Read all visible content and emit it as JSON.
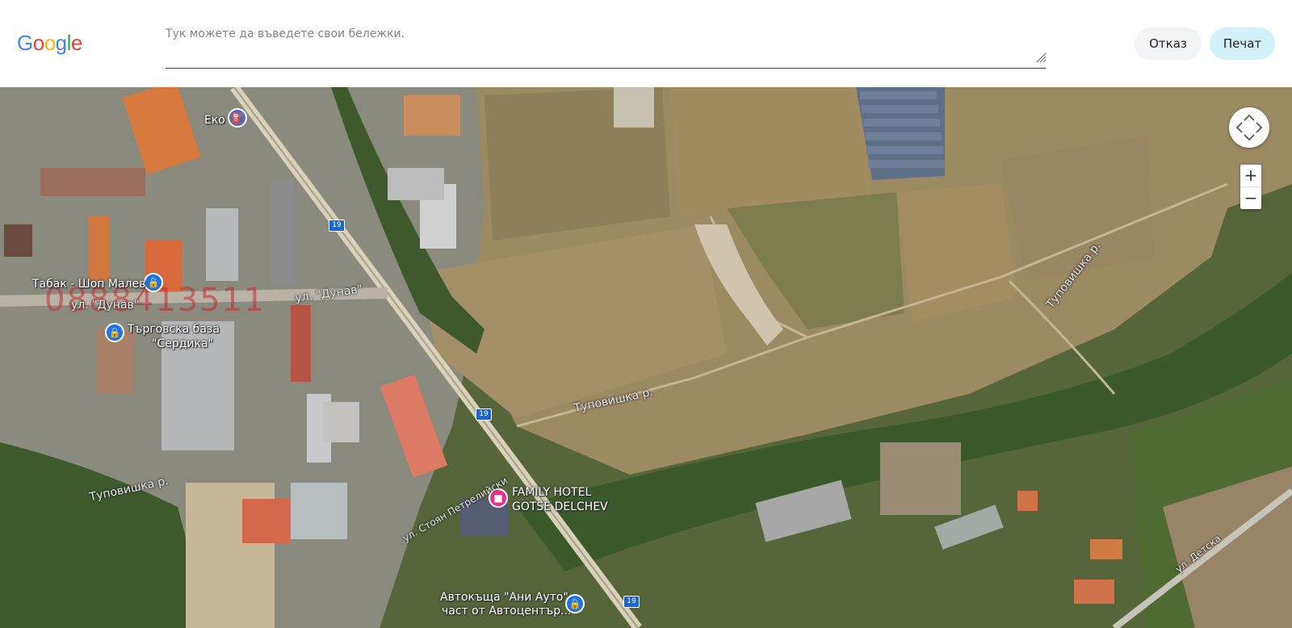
{
  "header": {
    "logo_letters": [
      {
        "ch": "G",
        "color": "#4285F4"
      },
      {
        "ch": "o",
        "color": "#EA4335"
      },
      {
        "ch": "o",
        "color": "#FBBC05"
      },
      {
        "ch": "g",
        "color": "#4285F4"
      },
      {
        "ch": "l",
        "color": "#34A853"
      },
      {
        "ch": "e",
        "color": "#EA4335"
      }
    ],
    "notes_placeholder": "Тук можете да въведете свои бележки.",
    "notes_value": "",
    "cancel_label": "Отказ",
    "print_label": "Печат"
  },
  "map": {
    "view": "satellite",
    "watermark_phone": "0888413511",
    "places": {
      "eko": "Еко",
      "tabak": "Табак - Шоп Малев",
      "targovska_line1": "Търговска база",
      "targovska_line2": "\"Сердика\"",
      "hotel_line1": "FAMILY HOTEL",
      "hotel_line2": "GOTSE DELCHEV",
      "autohouse_line1": "Автокъща \"Ани Ауто\"",
      "autohouse_line2": "част от Автоцентър..."
    },
    "roads": {
      "dunav_1": "ул. \"Дунав\"",
      "dunav_2": "ул. \"Дунав\"",
      "tupovishka_1": "Туповишка р.",
      "tupovishka_2": "Туповишка р.",
      "tupovishka_3": "Туповишка р.",
      "stoyan": "ул. Стоян Петрелийски",
      "detska": "ул. Детска"
    },
    "route_shields": [
      "19",
      "19",
      "19"
    ],
    "icons": {
      "fuel": "fuel-station-icon",
      "shopping": "shopping-bag-icon",
      "hotel": "bed-icon"
    },
    "controls": {
      "zoom_in": "+",
      "zoom_out": "−"
    }
  }
}
